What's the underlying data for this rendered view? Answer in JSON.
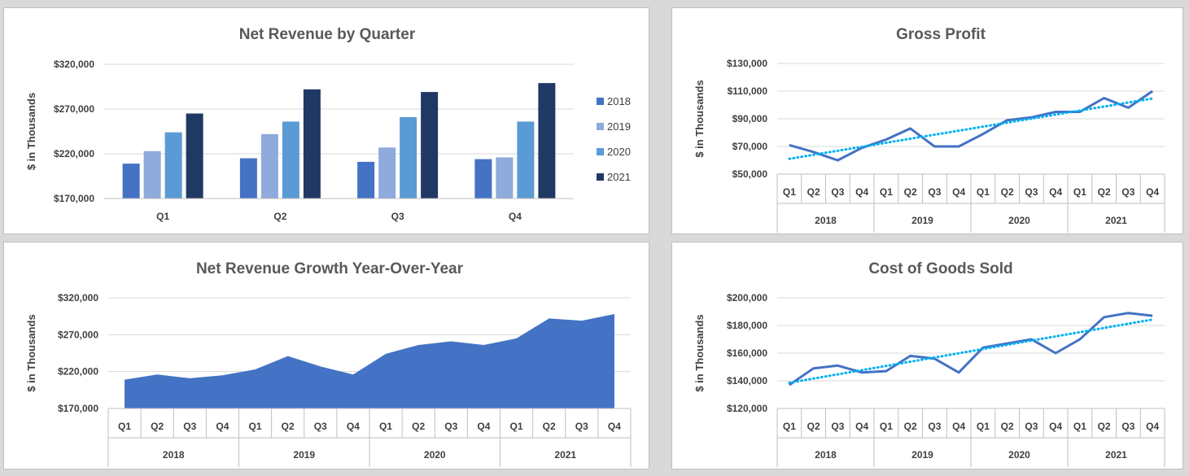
{
  "colors": {
    "s2018": "#4472c4",
    "s2019": "#8faadc",
    "s2020": "#5b9bd5",
    "s2021": "#203864",
    "area": "#4472c4",
    "line": "#4472c4",
    "trend": "#00b0f0",
    "grid": "#d9d9d9",
    "axis": "#bfbfbf"
  },
  "chart_data": [
    {
      "id": "net_revenue_by_quarter",
      "type": "bar",
      "title": "Net Revenue by Quarter",
      "ylabel": "$ in Thousands",
      "ylim": [
        170000,
        320000
      ],
      "yticks": [
        170000,
        220000,
        270000,
        320000
      ],
      "ytick_labels": [
        "$170,000",
        "$220,000",
        "$270,000",
        "$320,000"
      ],
      "categories": [
        "Q1",
        "Q2",
        "Q3",
        "Q4"
      ],
      "series": [
        {
          "name": "2018",
          "color": "#4472c4",
          "values": [
            209000,
            215000,
            211000,
            214000
          ]
        },
        {
          "name": "2019",
          "color": "#8faadc",
          "values": [
            223000,
            242000,
            227000,
            216000
          ]
        },
        {
          "name": "2020",
          "color": "#5b9bd5",
          "values": [
            244000,
            256000,
            261000,
            256000
          ]
        },
        {
          "name": "2021",
          "color": "#203864",
          "values": [
            265000,
            292000,
            289000,
            299000
          ]
        }
      ],
      "legend": "right",
      "grid": true
    },
    {
      "id": "gross_profit",
      "type": "line",
      "title": "Gross Profit",
      "ylabel": "$ in Thousands",
      "ylim": [
        50000,
        130000
      ],
      "yticks": [
        50000,
        70000,
        90000,
        110000,
        130000
      ],
      "ytick_labels": [
        "$50,000",
        "$70,000",
        "$90,000",
        "$110,000",
        "$130,000"
      ],
      "years": [
        "2018",
        "2019",
        "2020",
        "2021"
      ],
      "quarters": [
        "Q1",
        "Q2",
        "Q3",
        "Q4"
      ],
      "values": [
        71000,
        66000,
        60000,
        69000,
        75000,
        83000,
        70000,
        70000,
        79000,
        89000,
        91000,
        95000,
        95000,
        105000,
        98000,
        110000
      ],
      "trendline": "linear",
      "grid": true
    },
    {
      "id": "net_revenue_growth_yoy",
      "type": "area",
      "title": "Net Revenue Growth Year-Over-Year",
      "ylabel": "$ in Thousands",
      "ylim": [
        170000,
        320000
      ],
      "yticks": [
        170000,
        220000,
        270000,
        320000
      ],
      "ytick_labels": [
        "$170,000",
        "$220,000",
        "$270,000",
        "$320,000"
      ],
      "years": [
        "2018",
        "2019",
        "2020",
        "2021"
      ],
      "quarters": [
        "Q1",
        "Q2",
        "Q3",
        "Q4"
      ],
      "values": [
        209000,
        216000,
        211000,
        215000,
        223000,
        241000,
        227000,
        216000,
        244000,
        256000,
        261000,
        256000,
        265000,
        292000,
        289000,
        298000
      ],
      "grid": true
    },
    {
      "id": "cost_of_goods_sold",
      "type": "line",
      "title": "Cost of Goods Sold",
      "ylabel": "$ in Thousands",
      "ylim": [
        120000,
        200000
      ],
      "yticks": [
        120000,
        140000,
        160000,
        180000,
        200000
      ],
      "ytick_labels": [
        "$120,000",
        "$140,000",
        "$160,000",
        "$180,000",
        "$200,000"
      ],
      "years": [
        "2018",
        "2019",
        "2020",
        "2021"
      ],
      "quarters": [
        "Q1",
        "Q2",
        "Q3",
        "Q4"
      ],
      "values": [
        137000,
        149000,
        151000,
        146000,
        147000,
        158000,
        156000,
        146000,
        164000,
        167000,
        170000,
        160000,
        170000,
        186000,
        189000,
        187000
      ],
      "trendline": "linear",
      "grid": true
    }
  ]
}
